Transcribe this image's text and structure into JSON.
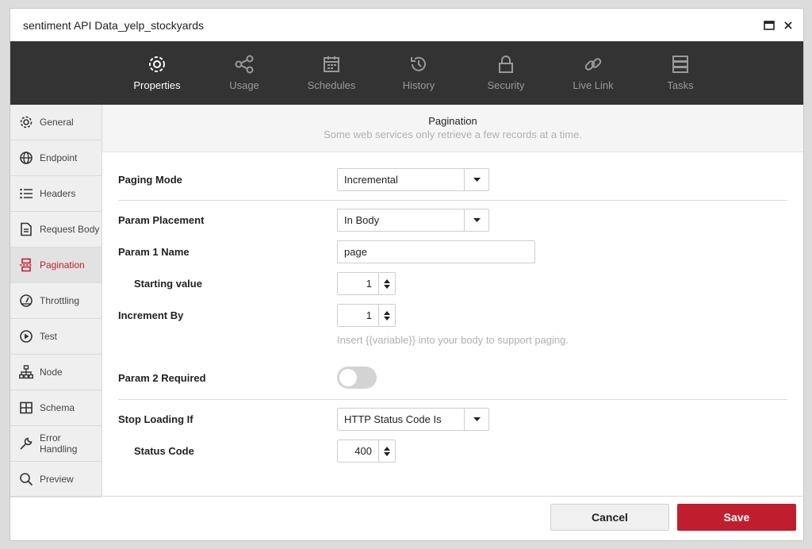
{
  "window": {
    "title": "sentiment API Data_yelp_stockyards"
  },
  "topnav": {
    "items": [
      {
        "label": "Properties",
        "icon": "gear-icon",
        "active": true
      },
      {
        "label": "Usage",
        "icon": "share-icon"
      },
      {
        "label": "Schedules",
        "icon": "calendar-icon"
      },
      {
        "label": "History",
        "icon": "history-icon"
      },
      {
        "label": "Security",
        "icon": "lock-icon"
      },
      {
        "label": "Live Link",
        "icon": "link-icon"
      },
      {
        "label": "Tasks",
        "icon": "tasks-icon"
      }
    ]
  },
  "sidebar": {
    "items": [
      {
        "label": "General",
        "icon": "gear-icon"
      },
      {
        "label": "Endpoint",
        "icon": "globe-icon"
      },
      {
        "label": "Headers",
        "icon": "list-icon"
      },
      {
        "label": "Request Body",
        "icon": "document-icon"
      },
      {
        "label": "Pagination",
        "icon": "pagination-icon",
        "active": true
      },
      {
        "label": "Throttling",
        "icon": "gauge-icon"
      },
      {
        "label": "Test",
        "icon": "play-icon"
      },
      {
        "label": "Node",
        "icon": "hierarchy-icon"
      },
      {
        "label": "Schema",
        "icon": "table-icon"
      },
      {
        "label": "Error Handling",
        "icon": "wrench-icon"
      },
      {
        "label": "Preview",
        "icon": "search-icon"
      }
    ]
  },
  "section": {
    "title": "Pagination",
    "subtitle": "Some web services only retrieve a few records at a time."
  },
  "form": {
    "paging_mode": {
      "label": "Paging Mode",
      "value": "Incremental"
    },
    "param_placement": {
      "label": "Param Placement",
      "value": "In Body"
    },
    "param1_name": {
      "label": "Param 1 Name",
      "value": "page"
    },
    "starting_value": {
      "label": "Starting value",
      "value": "1"
    },
    "increment_by": {
      "label": "Increment By",
      "value": "1"
    },
    "hint": "Insert {{variable}} into your body to support paging.",
    "param2_required": {
      "label": "Param 2 Required",
      "on": false
    },
    "stop_loading_if": {
      "label": "Stop Loading If",
      "value": "HTTP Status Code Is"
    },
    "status_code": {
      "label": "Status Code",
      "value": "400"
    }
  },
  "footer": {
    "cancel": "Cancel",
    "save": "Save"
  },
  "colors": {
    "accent": "#c01e2e",
    "nav_bg": "#333333"
  }
}
